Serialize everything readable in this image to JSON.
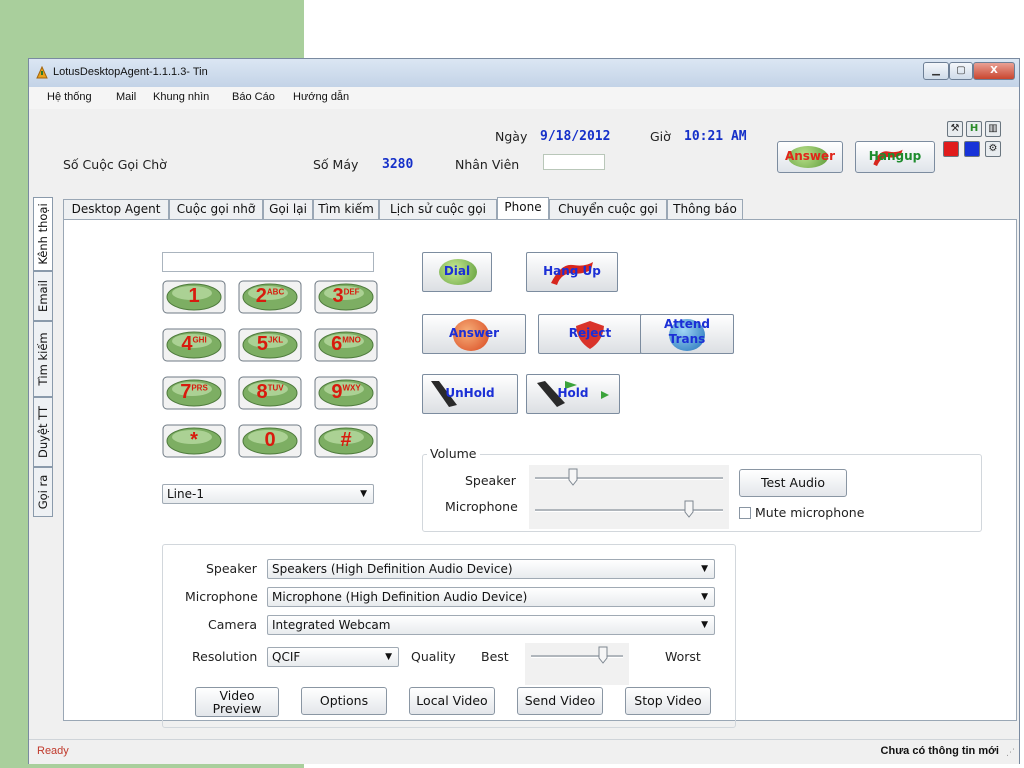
{
  "window": {
    "title": "LotusDesktopAgent-1.1.1.3- Tin"
  },
  "menu": [
    "Hệ thống",
    "Mail",
    "Khung nhìn",
    "Báo Cáo",
    "Hướng dẫn"
  ],
  "info": {
    "queue_label": "Số Cuộc Gọi Chờ",
    "extension_label": "Số Máy",
    "extension_value": "3280",
    "agent_label": "Nhân Viên",
    "date_label": "Ngày",
    "date_value": "9/18/2012",
    "time_label": "Giờ",
    "time_value": "10:21 AM",
    "answer_label": "Answer",
    "hangup_label": "Hangup"
  },
  "side_tabs": [
    "Kênh thoại",
    "Email",
    "Tìm kiếm",
    "Duyệt TT",
    "Gọi ra"
  ],
  "tabs": [
    "Desktop Agent",
    "Cuộc gọi nhỡ",
    "Gọi lại",
    "Tìm kiếm",
    "Lịch sử cuộc gọi",
    "Phone",
    "Chuyển cuộc gọi",
    "Thông báo"
  ],
  "keypad": [
    {
      "main": "1",
      "sub": ""
    },
    {
      "main": "2",
      "sub": "ABC"
    },
    {
      "main": "3",
      "sub": "DEF"
    },
    {
      "main": "4",
      "sub": "GHI"
    },
    {
      "main": "5",
      "sub": "JKL"
    },
    {
      "main": "6",
      "sub": "MNO"
    },
    {
      "main": "7",
      "sub": "PRS"
    },
    {
      "main": "8",
      "sub": "TUV"
    },
    {
      "main": "9",
      "sub": "WXY"
    },
    {
      "main": "*",
      "sub": ""
    },
    {
      "main": "0",
      "sub": ""
    },
    {
      "main": "#",
      "sub": ""
    }
  ],
  "line_select": "Line-1",
  "call_buttons": {
    "dial": "Dial",
    "hangup": "Hang Up",
    "answer": "Answer",
    "reject": "Reject",
    "attend_1": "Attend",
    "attend_2": "Trans",
    "unhold": "UnHold",
    "hold": "Hold"
  },
  "volume": {
    "legend": "Volume",
    "speaker_label": "Speaker",
    "mic_label": "Microphone",
    "test_audio": "Test Audio",
    "mute_label": "Mute microphone",
    "mute_checked": false,
    "speaker_level": 0.2,
    "mic_level": 0.82
  },
  "devices": {
    "speaker_label": "Speaker",
    "speaker_value": "Speakers (High Definition Audio Device)",
    "mic_label": "Microphone",
    "mic_value": "Microphone (High Definition Audio Device)",
    "camera_label": "Camera",
    "camera_value": "Integrated Webcam",
    "resolution_label": "Resolution",
    "resolution_value": "QCIF",
    "quality_label": "Quality",
    "quality_best": "Best",
    "quality_worst": "Worst",
    "quality_level": 0.78
  },
  "video_buttons": {
    "preview_1": "Video",
    "preview_2": "Preview",
    "options": "Options",
    "local": "Local Video",
    "send": "Send Video",
    "stop": "Stop Video"
  },
  "status": {
    "left": "Ready",
    "right": "Chưa có thông tin mới"
  },
  "colors": {
    "accent_blue": "#1530c9",
    "key_red": "#d81b0e",
    "button_blue": "#1b2fd6",
    "answer_red": "#e0261b",
    "hangup_green": "#1e8c2e"
  }
}
